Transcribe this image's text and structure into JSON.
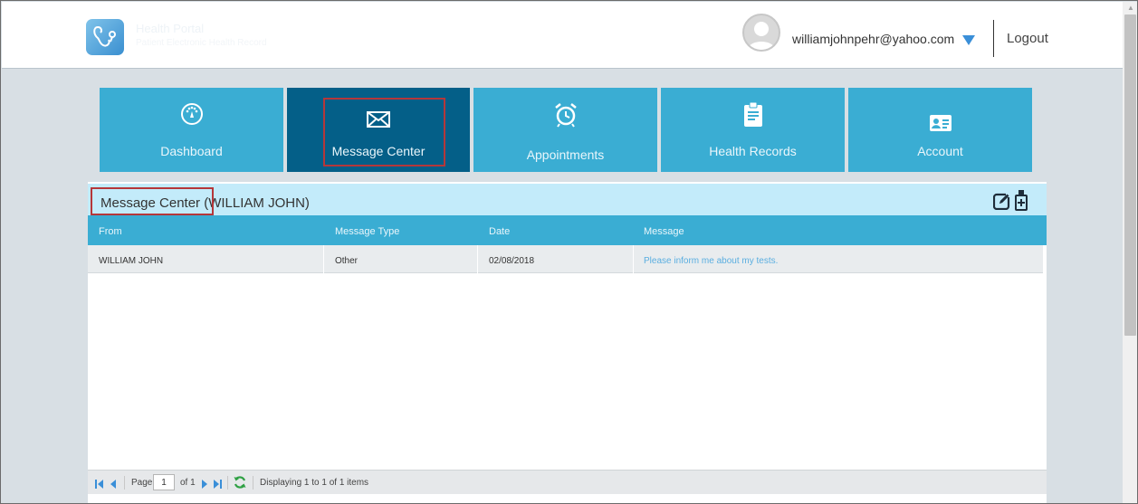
{
  "header": {
    "logo_text": "Health Portal",
    "logo_subtext": "Patient Electronic Health Record",
    "user_email": "williamjohnpehr@yahoo.com",
    "logout_label": "Logout"
  },
  "tabs": [
    {
      "label": "Dashboard",
      "icon": "gauge-icon",
      "active": false
    },
    {
      "label": "Message Center",
      "icon": "envelope-icon",
      "active": true
    },
    {
      "label": "Appointments",
      "icon": "alarm-clock-icon",
      "active": false
    },
    {
      "label": "Health Records",
      "icon": "clipboard-icon",
      "active": false
    },
    {
      "label": "Account",
      "icon": "id-card-icon",
      "active": false
    }
  ],
  "panel": {
    "title": "Message Center",
    "title_suffix": " (WILLIAM JOHN)",
    "columns": [
      "From",
      "Message Type",
      "Date",
      "Message"
    ],
    "rows": [
      {
        "from": "WILLIAM JOHN",
        "type": "Other",
        "date": "02/08/2018",
        "message": "Please inform me about my tests."
      }
    ]
  },
  "pager": {
    "page_label": "Page",
    "page_value": "1",
    "of_label": "of 1",
    "display_text": "Displaying 1 to 1 of 1 items"
  },
  "colors": {
    "tab": "#3aadd3",
    "tab_active": "#045f88",
    "title_bar": "#c3ebfa",
    "highlight": "#b5373a",
    "link": "#5aaee0"
  }
}
